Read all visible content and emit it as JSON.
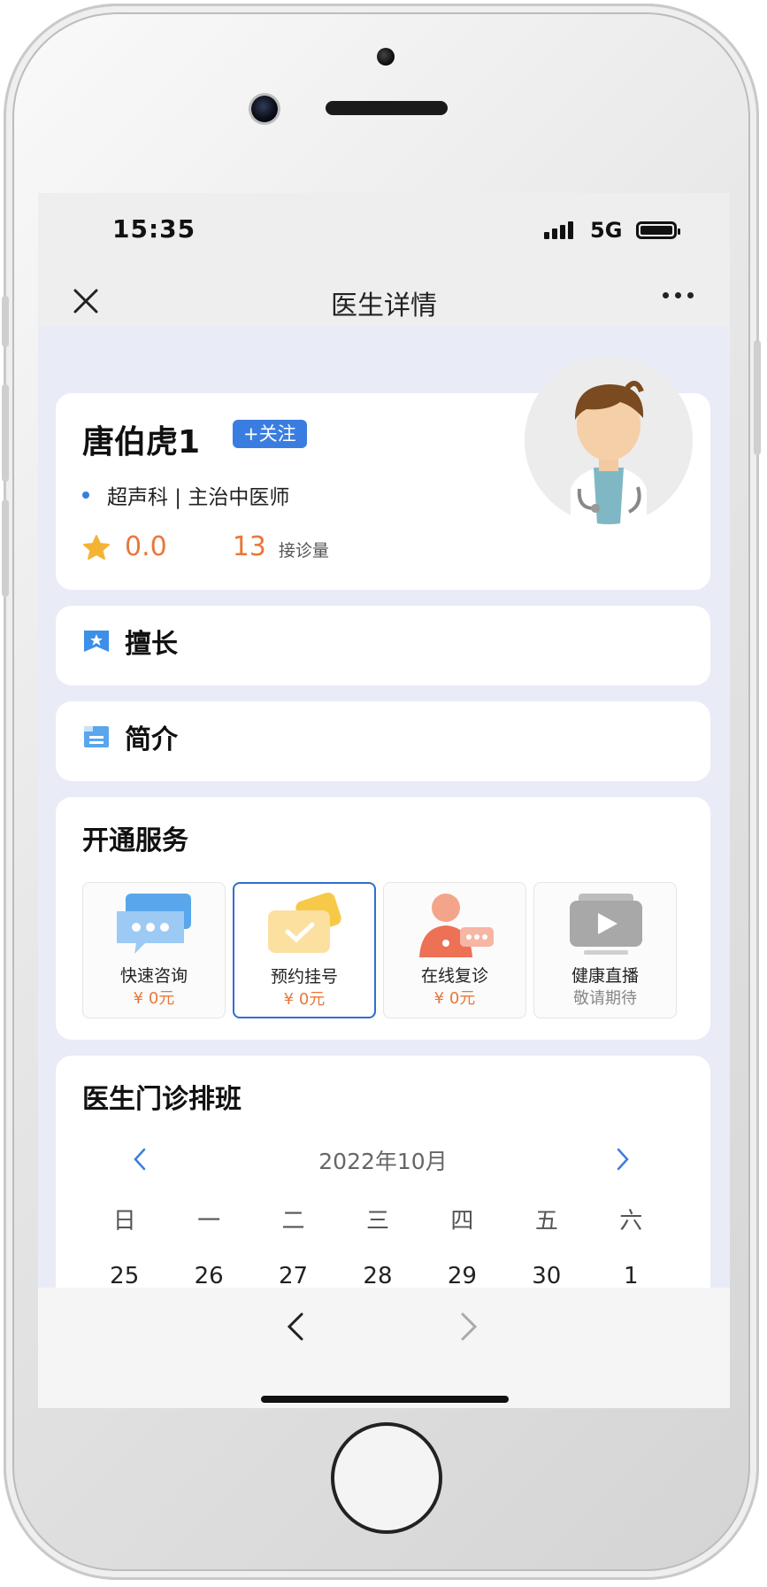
{
  "status": {
    "time": "15:35",
    "network": "5G"
  },
  "nav": {
    "title": "医生详情"
  },
  "doctor": {
    "name": "唐伯虎1",
    "follow_label": "+关注",
    "department": "超声科 | 主治中医师",
    "rating": "0.0",
    "consult_count": "13",
    "consult_count_label": "接诊量"
  },
  "sections": {
    "expertise_title": "擅长",
    "intro_title": "简介"
  },
  "services": {
    "title": "开通服务",
    "items": [
      {
        "label": "快速咨询",
        "price": "¥ 0元",
        "icon": "chat-bubble-icon"
      },
      {
        "label": "预约挂号",
        "price": "¥ 0元",
        "icon": "appointment-check-icon"
      },
      {
        "label": "在线复诊",
        "price": "¥ 0元",
        "icon": "doctor-chat-icon"
      },
      {
        "label": "健康直播",
        "price": "敬请期待",
        "icon": "video-play-icon"
      }
    ],
    "selected_index": 1
  },
  "schedule": {
    "title": "医生门诊排班",
    "month": "2022年10月",
    "weekdays": [
      "日",
      "一",
      "二",
      "三",
      "四",
      "五",
      "六"
    ],
    "dates": [
      "25",
      "26",
      "27",
      "28",
      "29",
      "30",
      "1"
    ]
  },
  "colors": {
    "accent": "#3a7de0",
    "price": "#e8783a",
    "background": "#e9ecf7"
  }
}
